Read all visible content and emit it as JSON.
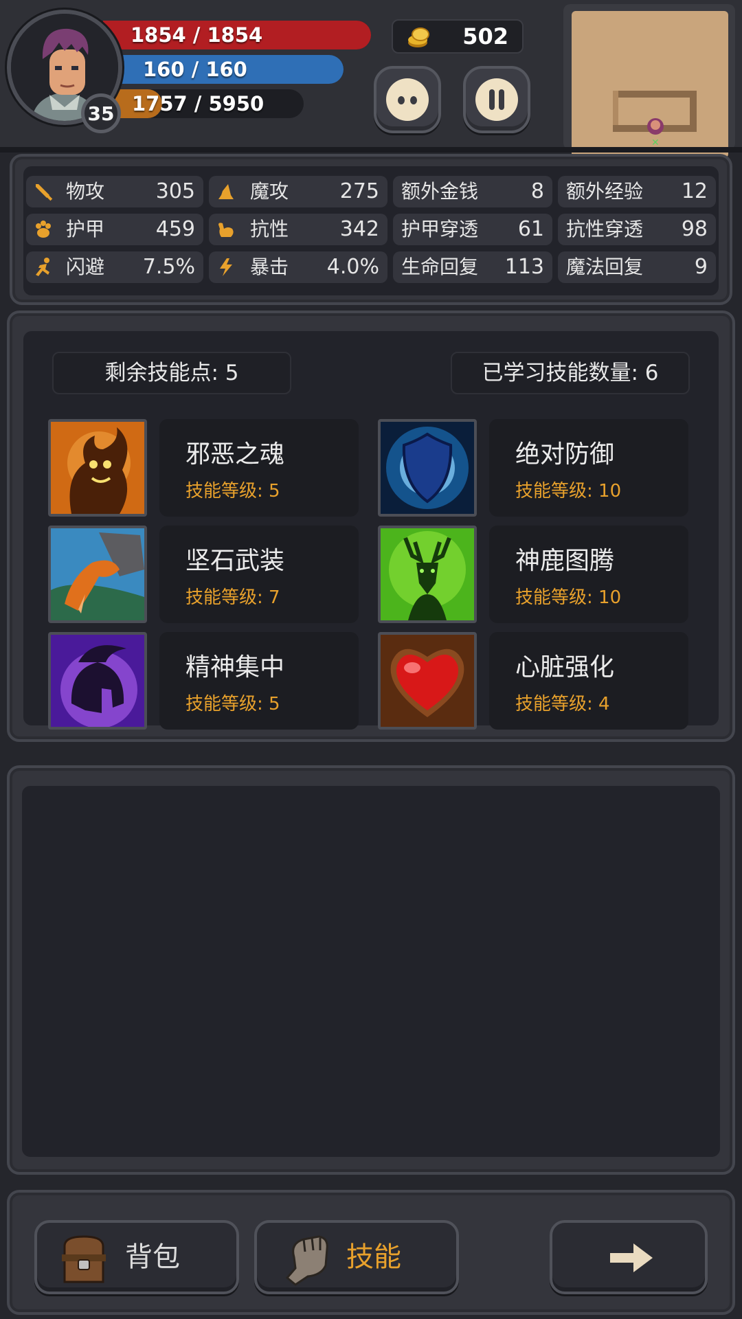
{
  "player": {
    "level": "35",
    "hp_text": "1854 / 1854",
    "hp_fraction": 1.0,
    "mp_text": "160 / 160",
    "mp_fraction": 1.0,
    "xp_text": "1757 / 5950",
    "xp_fraction": 0.295
  },
  "gold": "502",
  "colors": {
    "hp": "#b21e22",
    "mp": "#2f6fb6",
    "xp": "#b86c1c",
    "accent": "#e8a12c"
  },
  "stats": [
    {
      "icon": "sword-icon",
      "label": "物攻",
      "value": "305"
    },
    {
      "icon": "wizard-hat-icon",
      "label": "魔攻",
      "value": "275"
    },
    {
      "label": "额外金钱",
      "value": "8"
    },
    {
      "label": "额外经验",
      "value": "12"
    },
    {
      "icon": "paw-icon",
      "label": "护甲",
      "value": "459"
    },
    {
      "icon": "muscle-icon",
      "label": "抗性",
      "value": "342"
    },
    {
      "label": "护甲穿透",
      "value": "61"
    },
    {
      "label": "抗性穿透",
      "value": "98"
    },
    {
      "icon": "running-icon",
      "label": "闪避",
      "value": "7.5%"
    },
    {
      "icon": "lightning-icon",
      "label": "暴击",
      "value": "4.0%"
    },
    {
      "label": "生命回复",
      "value": "113"
    },
    {
      "label": "魔法回复",
      "value": "9"
    }
  ],
  "skills_panel": {
    "remaining_points": "剩余技能点: 5",
    "learned_count": "已学习技能数量: 6"
  },
  "skills": [
    {
      "icon": "evil-soul-icon",
      "name": "邪恶之魂",
      "level": "技能等级: 5"
    },
    {
      "icon": "shield-icon",
      "name": "绝对防御",
      "level": "技能等级: 10"
    },
    {
      "icon": "stone-claw-icon",
      "name": "坚石武装",
      "level": "技能等级: 7"
    },
    {
      "icon": "deer-totem-icon",
      "name": "神鹿图腾",
      "level": "技能等级: 10"
    },
    {
      "icon": "helmet-icon",
      "name": "精神集中",
      "level": "技能等级: 5"
    },
    {
      "icon": "heart-icon",
      "name": "心脏强化",
      "level": "技能等级: 4"
    }
  ],
  "nav": {
    "backpack": "背包",
    "skills": "技能",
    "next_icon": "arrow-right-icon"
  }
}
